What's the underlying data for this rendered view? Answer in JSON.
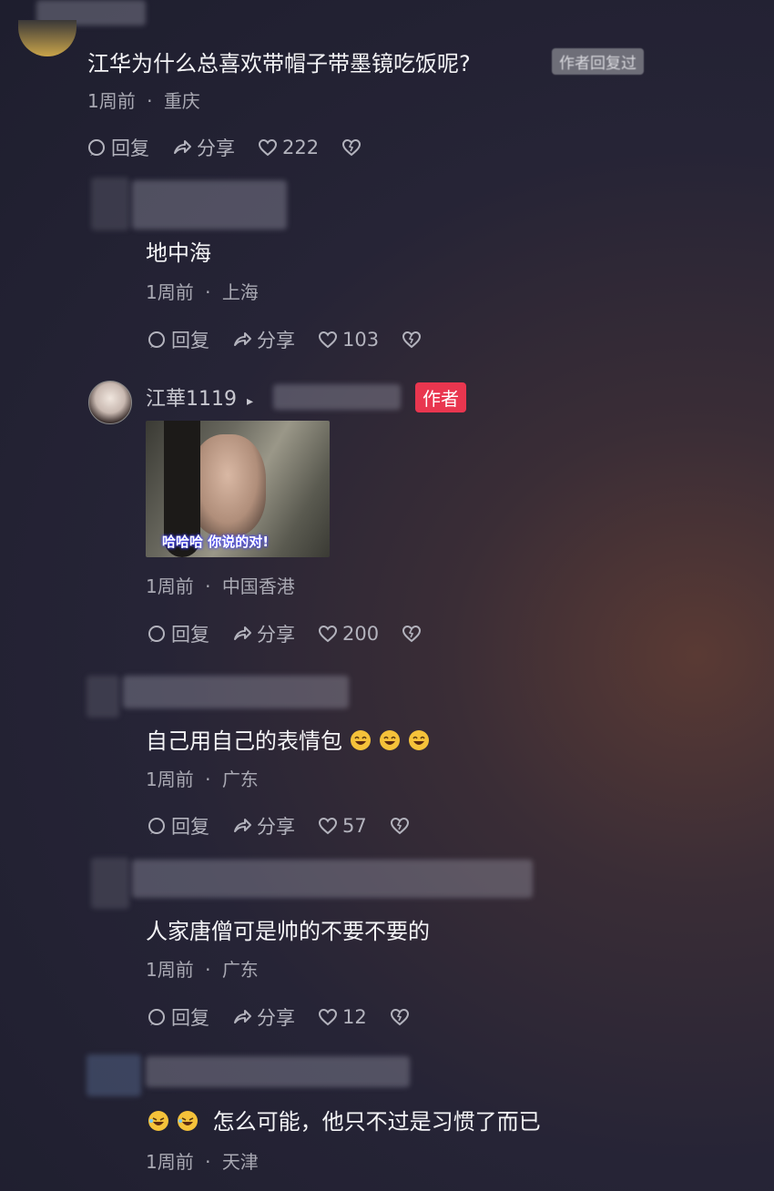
{
  "comments": [
    {
      "text": "江华为什么总喜欢带帽子带墨镜吃饭呢?",
      "badge": "作者回复过",
      "time": "1周前",
      "location": "重庆",
      "reply": "回复",
      "share": "分享",
      "likes": "222"
    },
    {
      "text": "地中海",
      "time": "1周前",
      "location": "上海",
      "reply": "回复",
      "share": "分享",
      "likes": "103"
    },
    {
      "username": "江華1119",
      "badge": "作者",
      "image_caption": "哈哈哈 你说的对!",
      "time": "1周前",
      "location": "中国香港",
      "reply": "回复",
      "share": "分享",
      "likes": "200"
    },
    {
      "text": "自己用自己的表情包",
      "emoji": "grinning-face-icon",
      "time": "1周前",
      "location": "广东",
      "reply": "回复",
      "share": "分享",
      "likes": "57"
    },
    {
      "text": "人家唐僧可是帅的不要不要的",
      "time": "1周前",
      "location": "广东",
      "reply": "回复",
      "share": "分享",
      "likes": "12"
    },
    {
      "text": "怎么可能，他只不过是习惯了而已",
      "emoji": "rofl-face-icon",
      "time": "1周前",
      "location": "天津"
    }
  ],
  "meta_separator": "·",
  "colors": {
    "accent_red": "#e9364f",
    "text": "#f2f2f4",
    "meta": "#a9a9b3"
  }
}
